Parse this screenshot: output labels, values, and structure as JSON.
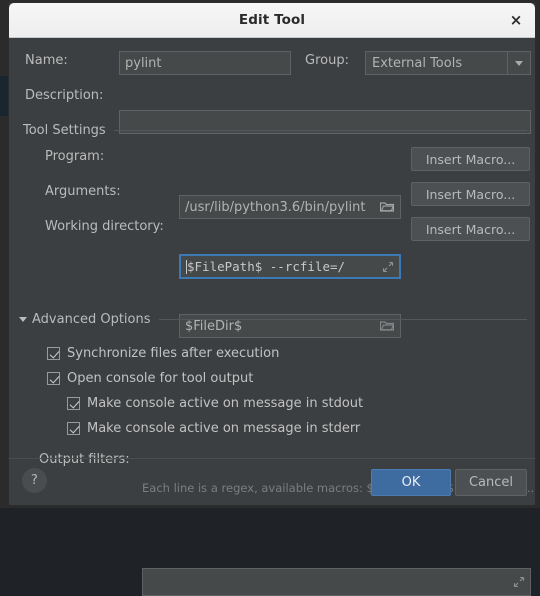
{
  "window": {
    "title": "Edit Tool",
    "close_label": "×"
  },
  "form": {
    "name_label": "Name:",
    "name_value": "pylint",
    "group_label": "Group:",
    "group_value": "External Tools",
    "description_label": "Description:",
    "description_value": "",
    "description_placeholder": ""
  },
  "tool_settings": {
    "title": "Tool Settings",
    "program_label": "Program:",
    "program_value": "/usr/lib/python3.6/bin/pylint",
    "arguments_label": "Arguments:",
    "arguments_value": "$FilePath$ --rcfile=/",
    "working_dir_label": "Working directory:",
    "working_dir_value": "$FileDir$",
    "insert_macro_label": "Insert Macro...",
    "folder_icon": "folder-icon",
    "expand_icon": "expand-icon"
  },
  "advanced_options": {
    "title": "Advanced Options",
    "expanded": true,
    "checkboxes": [
      {
        "label": "Synchronize files after execution",
        "checked": true,
        "indent": 0
      },
      {
        "label": "Open console for tool output",
        "checked": true,
        "indent": 0
      },
      {
        "label": "Make console active on message in stdout",
        "checked": true,
        "indent": 1
      },
      {
        "label": "Make console active on message in stderr",
        "checked": true,
        "indent": 1
      }
    ],
    "output_filters_label": "Output filters:",
    "output_filters_value": "",
    "output_filters_hint": "Each line is a regex, available macros: $FILE_PATH$, $LINE$ and $..."
  },
  "footer": {
    "help_label": "?",
    "ok_label": "OK",
    "cancel_label": "Cancel"
  },
  "colors": {
    "dialog_bg": "#3c3f41",
    "field_bg": "#45494a",
    "accent_blue": "#3f6ca0",
    "focus_blue": "#3d7ab5",
    "text": "#bbbbbb",
    "hint_text": "#7a7e80",
    "titlebar_bg": "#f2f2f2"
  }
}
